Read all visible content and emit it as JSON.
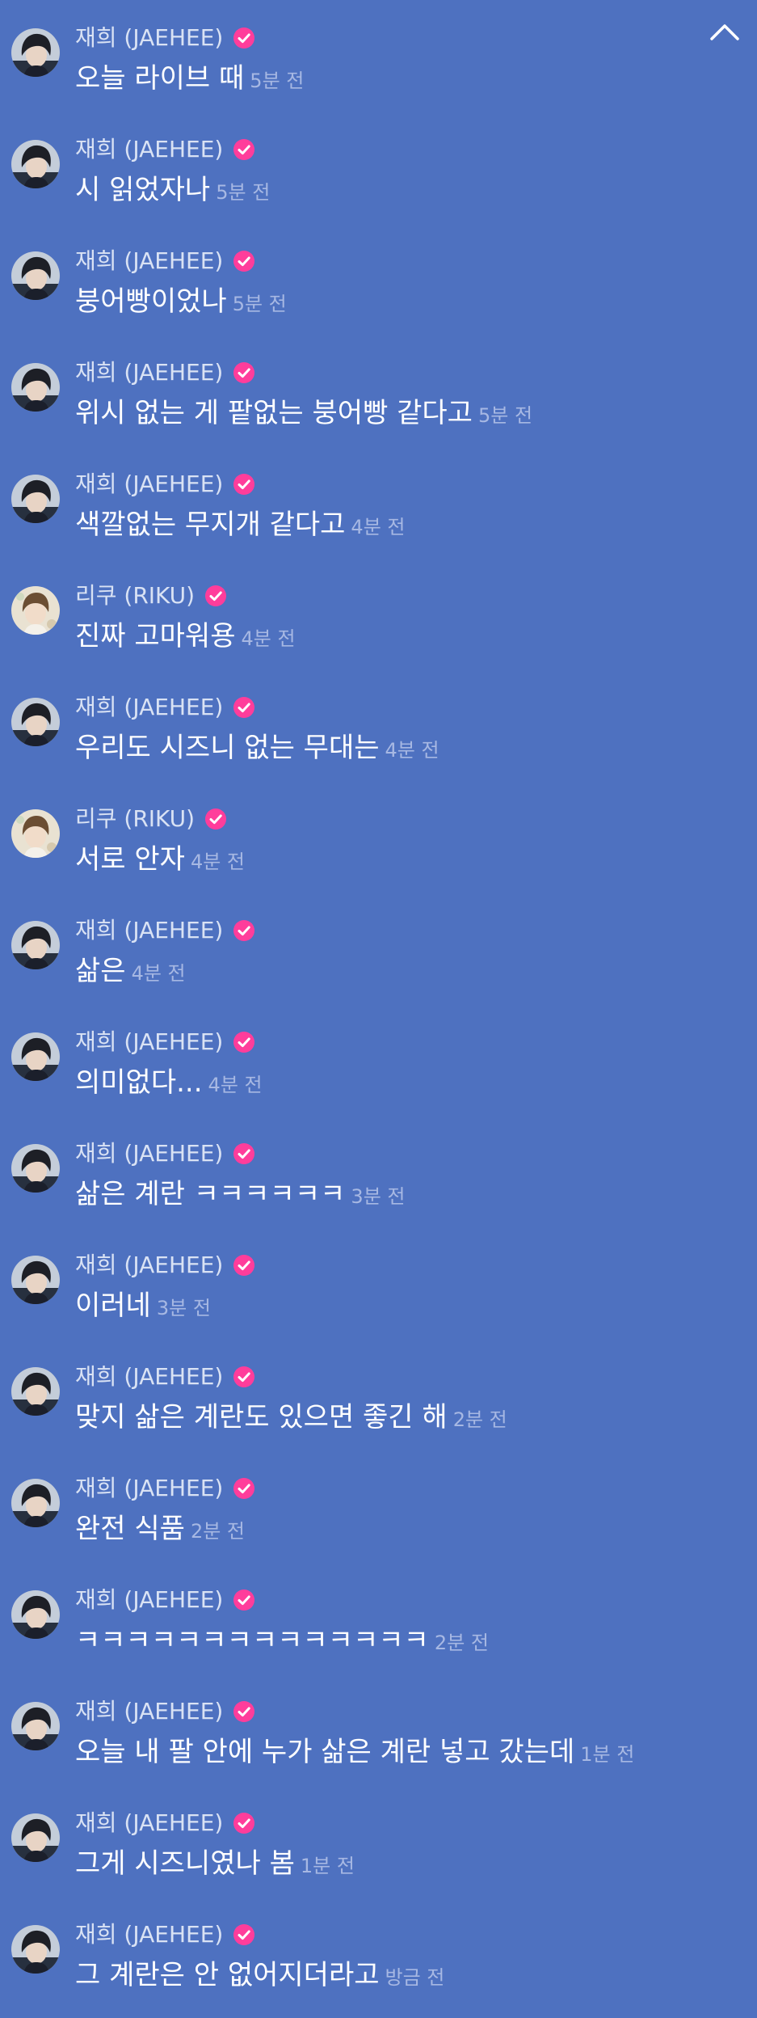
{
  "colors": {
    "background": "#4e71c0",
    "verified_badge": "#ff3d9b",
    "name_text": "#d9e2f4",
    "message_text": "#ffffff",
    "time_text": "#a7b8e3"
  },
  "header": {
    "collapse_icon": "chevron-up-icon"
  },
  "messages": [
    {
      "user": "재희 (JAEHEE)",
      "avatar": "jaehee",
      "verified": true,
      "text": "오늘 라이브 때",
      "time": "5분 전"
    },
    {
      "user": "재희 (JAEHEE)",
      "avatar": "jaehee",
      "verified": true,
      "text": "시 읽었자나",
      "time": "5분 전"
    },
    {
      "user": "재희 (JAEHEE)",
      "avatar": "jaehee",
      "verified": true,
      "text": "붕어빵이었나",
      "time": "5분 전"
    },
    {
      "user": "재희 (JAEHEE)",
      "avatar": "jaehee",
      "verified": true,
      "text": "위시 없는 게 팥없는 붕어빵 같다고",
      "time": "5분 전"
    },
    {
      "user": "재희 (JAEHEE)",
      "avatar": "jaehee",
      "verified": true,
      "text": "색깔없는 무지개 같다고",
      "time": "4분 전"
    },
    {
      "user": "리쿠 (RIKU)",
      "avatar": "riku",
      "verified": true,
      "text": "진짜 고마워용",
      "time": "4분 전"
    },
    {
      "user": "재희 (JAEHEE)",
      "avatar": "jaehee",
      "verified": true,
      "text": "우리도 시즈니 없는 무대는",
      "time": "4분 전"
    },
    {
      "user": "리쿠 (RIKU)",
      "avatar": "riku",
      "verified": true,
      "text": "서로 안자",
      "time": "4분 전"
    },
    {
      "user": "재희 (JAEHEE)",
      "avatar": "jaehee",
      "verified": true,
      "text": "삶은",
      "time": "4분 전"
    },
    {
      "user": "재희 (JAEHEE)",
      "avatar": "jaehee",
      "verified": true,
      "text": "의미없다...",
      "time": "4분 전"
    },
    {
      "user": "재희 (JAEHEE)",
      "avatar": "jaehee",
      "verified": true,
      "text": "삶은 계란 ㅋㅋㅋㅋㅋㅋ",
      "time": "3분 전"
    },
    {
      "user": "재희 (JAEHEE)",
      "avatar": "jaehee",
      "verified": true,
      "text": "이러네",
      "time": "3분 전"
    },
    {
      "user": "재희 (JAEHEE)",
      "avatar": "jaehee",
      "verified": true,
      "text": "맞지 삶은 계란도 있으면 좋긴 해",
      "time": "2분 전"
    },
    {
      "user": "재희 (JAEHEE)",
      "avatar": "jaehee",
      "verified": true,
      "text": "완전 식품",
      "time": "2분 전"
    },
    {
      "user": "재희 (JAEHEE)",
      "avatar": "jaehee",
      "verified": true,
      "text": "ㅋㅋㅋㅋㅋㅋㅋㅋㅋㅋㅋㅋㅋㅋ",
      "time": "2분 전"
    },
    {
      "user": "재희 (JAEHEE)",
      "avatar": "jaehee",
      "verified": true,
      "text": "오늘 내 팔 안에 누가 삶은 계란 넣고 갔는데",
      "time": "1분 전"
    },
    {
      "user": "재희 (JAEHEE)",
      "avatar": "jaehee",
      "verified": true,
      "text": "그게 시즈니였나 봄",
      "time": "1분 전"
    },
    {
      "user": "재희 (JAEHEE)",
      "avatar": "jaehee",
      "verified": true,
      "text": "그 계란은 안 없어지더라고",
      "time": "방금 전"
    }
  ]
}
